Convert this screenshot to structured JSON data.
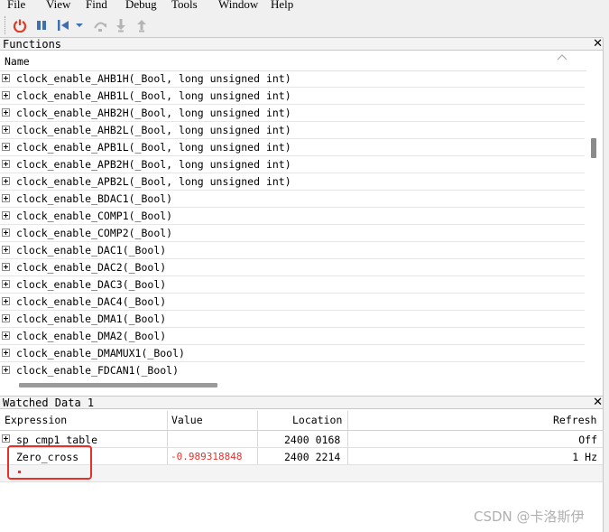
{
  "menu": [
    "File",
    "View",
    "Find",
    "Debug",
    "Tools",
    "Window",
    "Help"
  ],
  "toolbar": {
    "icons": [
      "power-icon",
      "pause-icon",
      "reset-icon",
      "dropdown-arrow-icon",
      "step-over-icon",
      "step-into-icon",
      "step-out-icon"
    ]
  },
  "functions": {
    "title": "Functions",
    "column_name": "Name",
    "items": [
      "clock_enable_AHB1H(_Bool, long unsigned int)",
      "clock_enable_AHB1L(_Bool, long unsigned int)",
      "clock_enable_AHB2H(_Bool, long unsigned int)",
      "clock_enable_AHB2L(_Bool, long unsigned int)",
      "clock_enable_APB1L(_Bool, long unsigned int)",
      "clock_enable_APB2H(_Bool, long unsigned int)",
      "clock_enable_APB2L(_Bool, long unsigned int)",
      "clock_enable_BDAC1(_Bool)",
      "clock_enable_COMP1(_Bool)",
      "clock_enable_COMP2(_Bool)",
      "clock_enable_DAC1(_Bool)",
      "clock_enable_DAC2(_Bool)",
      "clock_enable_DAC3(_Bool)",
      "clock_enable_DAC4(_Bool)",
      "clock_enable_DMA1(_Bool)",
      "clock_enable_DMA2(_Bool)",
      "clock_enable_DMAMUX1(_Bool)",
      "clock_enable_FDCAN1(_Bool)"
    ]
  },
  "watched": {
    "title": "Watched Data 1",
    "columns": {
      "expression": "Expression",
      "value": "Value",
      "location": "Location",
      "refresh": "Refresh"
    },
    "rows": [
      {
        "expression": "sp_cmp1_table",
        "value": "",
        "location": "2400 0168",
        "refresh": "Off"
      },
      {
        "expression": "Zero_cross",
        "value": "-0.989318848",
        "location": "2400 2214",
        "refresh": "1 Hz"
      }
    ],
    "value_color": "#e8302a",
    "highlight_color": "#e8302a"
  },
  "watermark": "CSDN @卡洛斯伊"
}
